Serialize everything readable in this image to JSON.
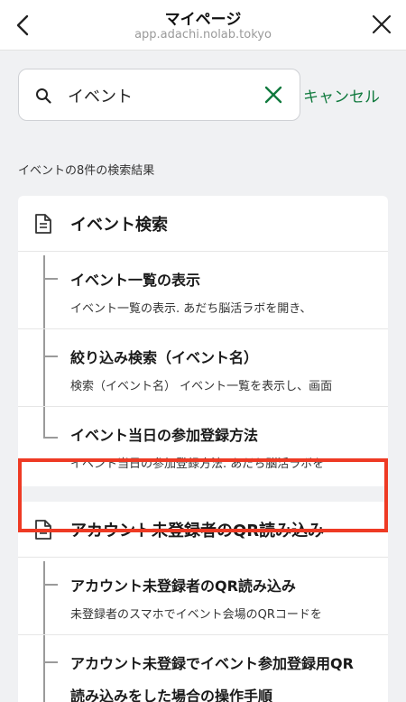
{
  "header": {
    "title": "マイページ",
    "url": "app.adachi.nolab.tokyo"
  },
  "search": {
    "value": "イベント",
    "cancel_label": "キャンセル"
  },
  "results": {
    "count_text": "イベントの8件の検索結果"
  },
  "groups": [
    {
      "title": "イベント検索",
      "items": [
        {
          "title": "イベント一覧の表示",
          "desc": "イベント一覧の表示. あだち脳活ラボを開き、"
        },
        {
          "title": "絞り込み検索（イベント名）",
          "desc": "検索（イベント名） イベント一覧を表示し、画面"
        },
        {
          "title": "イベント当日の参加登録方法",
          "desc": "イベント当日の参加登録方法. あだち脳活ラボを"
        }
      ]
    },
    {
      "title": "アカウント未登録者のQR読み込み",
      "items": [
        {
          "title": "アカウント未登録者のQR読み込み",
          "desc": "未登録者のスマホでイベント会場のQRコードを"
        },
        {
          "title_line1": "アカウント未登録でイベント参加登録用QR",
          "title_line2": "読み込みをした場合の操作手順"
        }
      ]
    }
  ],
  "colors": {
    "accent": "#117a3e",
    "highlight": "#ee3a24",
    "background": "#f0f1f3"
  },
  "icons": {
    "back": "chevron-left-icon",
    "close": "close-icon",
    "search": "search-icon",
    "clear": "clear-icon",
    "document": "document-icon"
  }
}
